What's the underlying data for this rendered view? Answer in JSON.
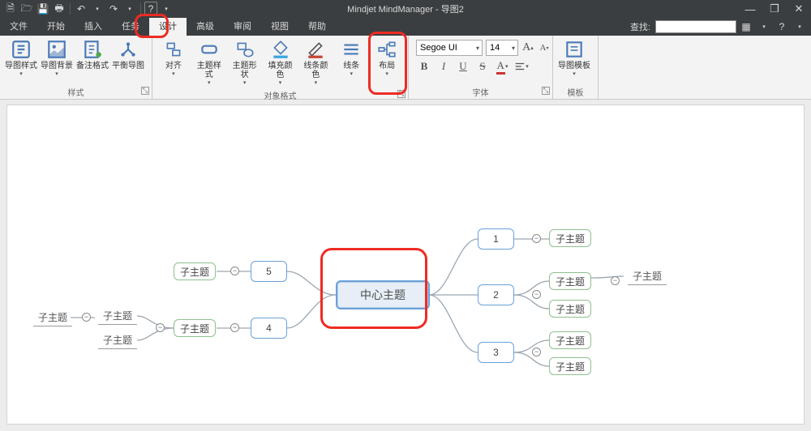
{
  "app": {
    "title": "Mindjet MindManager - 导图2"
  },
  "qat": {
    "new": "🗎",
    "open": "🗁",
    "save": "💾",
    "print": "🖶",
    "undo": "↶",
    "redo": "↷",
    "help": "?"
  },
  "win": {
    "min": "—",
    "max": "❐",
    "close": "✕"
  },
  "menu": {
    "items": [
      "文件",
      "开始",
      "插入",
      "任务",
      "设计",
      "高级",
      "审阅",
      "视图",
      "帮助"
    ],
    "active_index": 4,
    "find_label": "查找:",
    "find_value": ""
  },
  "ribbon": {
    "groups": [
      {
        "name": "样式",
        "buttons": [
          {
            "id": "map-style",
            "label": "导图样式",
            "dd": true
          },
          {
            "id": "map-bg",
            "label": "导图背景",
            "dd": true
          },
          {
            "id": "note-style",
            "label": "备注格式",
            "dd": false
          },
          {
            "id": "balance",
            "label": "平衡导图",
            "dd": false
          }
        ]
      },
      {
        "name": "对象格式",
        "buttons": [
          {
            "id": "align",
            "label": "对齐",
            "dd": true
          },
          {
            "id": "topic-style",
            "label": "主题样式",
            "dd": true
          },
          {
            "id": "topic-shape",
            "label": "主题形状",
            "dd": true
          },
          {
            "id": "fill-color",
            "label": "填充颜色",
            "dd": true
          },
          {
            "id": "line-color",
            "label": "线条颜色",
            "dd": true
          },
          {
            "id": "line",
            "label": "线条",
            "dd": true
          },
          {
            "id": "layout",
            "label": "布局",
            "dd": true
          }
        ]
      },
      {
        "name": "字体",
        "font_name": "Segoe UI",
        "font_size": "14",
        "grow": "A",
        "shrink": "A"
      },
      {
        "name": "模板",
        "buttons": [
          {
            "id": "map-template",
            "label": "导图模板",
            "dd": true
          }
        ]
      }
    ]
  },
  "map": {
    "center": "中心主题",
    "left_branches": [
      {
        "num": "5",
        "subs": [
          "子主题"
        ]
      },
      {
        "num": "4",
        "subs": [
          "子主题"
        ],
        "grand": [
          "子主题",
          "子主题"
        ],
        "great": [
          "子主题"
        ]
      }
    ],
    "right_branches": [
      {
        "num": "1",
        "subs": [
          "子主题"
        ]
      },
      {
        "num": "2",
        "subs": [
          "子主题",
          "子主题"
        ],
        "grand": [
          "子主题"
        ]
      },
      {
        "num": "3",
        "subs": [
          "子主题",
          "子主题"
        ]
      }
    ],
    "toggle_minus": "−"
  }
}
